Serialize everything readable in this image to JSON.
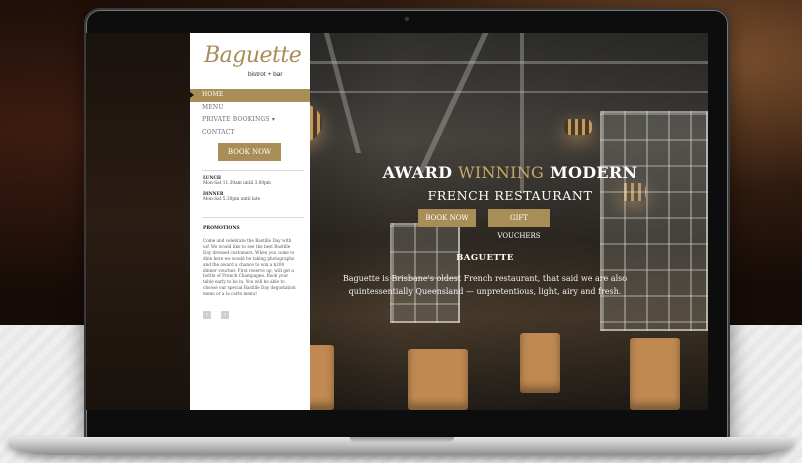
{
  "brand": {
    "name": "Baguette",
    "tagline": "bistrot + bar",
    "accent_color": "#a88d57"
  },
  "nav": {
    "items": [
      {
        "label": "HOME",
        "active": true
      },
      {
        "label": "MENU",
        "active": false
      },
      {
        "label": "PRIVATE BOOKINGS ▾",
        "active": false
      },
      {
        "label": "CONTACT",
        "active": false
      }
    ]
  },
  "sidebar": {
    "book_now": "BOOK NOW",
    "lunch": {
      "title": "LUNCH",
      "hours": "Mon-Sat 11.30am until 3.00pm"
    },
    "dinner": {
      "title": "DINNER",
      "hours": "Mon-Sat 5.30pm until late"
    },
    "promotions": {
      "title": "PROMOTIONS",
      "text": "Come and celebrate the Bastille Day with us! We would like to see the best Bastille Day dressed customers. When you come to dine here we would be taking photographs and the award a chance to win a $200 dinner voucher. First reserve up, will get a bottle of French Champagne. Book your table early to be in. You will be able to choose our special Bastille Day degustation menu or a la carte menu!"
    },
    "pager_prev": "‹",
    "pager_next": "›"
  },
  "hero": {
    "title_part1": "AWARD ",
    "title_part2": "WINNING",
    "title_part3": " MODERN",
    "subtitle": "FRENCH RESTAURANT",
    "book_now": "BOOK NOW",
    "gift_vouchers": "GIFT VOUCHERS",
    "heading": "BAGUETTE",
    "body": "Baguette is Brisbane's oldest French restaurant, that said we are also quintessentially Queensland — unpretentious, light, airy and fresh."
  }
}
